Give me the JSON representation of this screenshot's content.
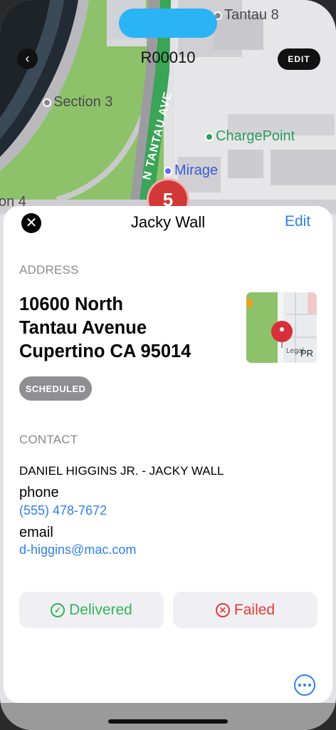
{
  "nav": {
    "title": "R00010",
    "edit_label": "EDIT",
    "back_icon": "chevron-left-icon"
  },
  "map": {
    "pois": [
      {
        "label": "Tantau 8",
        "type": "place"
      },
      {
        "label": "Section 3",
        "type": "place"
      },
      {
        "label": "ChargePoint",
        "type": "ev-charger"
      },
      {
        "label": "Mirage",
        "type": "business"
      },
      {
        "label": "on 4",
        "type": "place"
      }
    ],
    "road_label": "N TANTAU AVE",
    "cluster_count": "5",
    "colors": {
      "cluster": "#d23838",
      "road": "#3aa457",
      "park": "#8fc46a",
      "poi_green": "#2e9b5d",
      "poi_blue": "#3c5bd0"
    }
  },
  "sheet": {
    "title": "Jacky Wall",
    "edit_label": "Edit",
    "address_label": "ADDRESS",
    "address_lines": [
      "10600 North",
      "Tantau Avenue",
      "Cupertino CA 95014"
    ],
    "status_badge": "SCHEDULED",
    "thumbnail_legal": "Legal",
    "thumbnail_road": "PR",
    "contact_label": "CONTACT",
    "contact_name": "DANIEL HIGGINS JR. - JACKY WALL",
    "phone_label": "phone",
    "phone_value": "(555) 478-7672",
    "email_label": "email",
    "email_value": "d-higgins@mac.com",
    "delivered_label": "Delivered",
    "failed_label": "Failed",
    "colors": {
      "accent": "#2f7ff0",
      "delivered": "#33b553",
      "failed": "#e63a32",
      "badge": "#8e8e93"
    }
  }
}
